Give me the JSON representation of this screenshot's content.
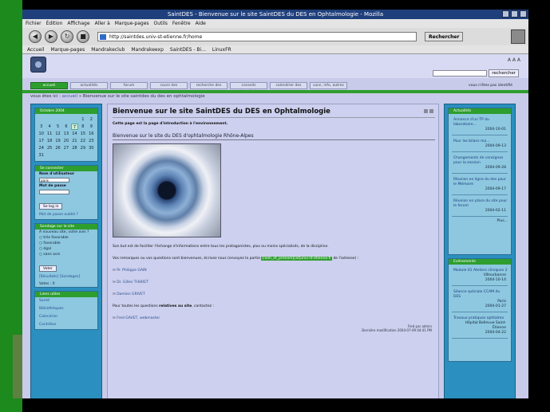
{
  "window": {
    "title": "SaintDES - Bienvenue sur le site SaintDES du DES en Ophtalmologie - Mozilla"
  },
  "menu": [
    "Fichier",
    "Édition",
    "Affichage",
    "Aller à",
    "Marque-pages",
    "Outils",
    "Fenêtre",
    "Aide"
  ],
  "url": "http://saintdes.univ-st-etienne.fr/home",
  "search_button": "Rechercher",
  "bookmarks": [
    "Accueil",
    "Marque-pages",
    "Mandrakeclub",
    "Mandrakeexp",
    "SaintDES - Bi...",
    "LinuxFR"
  ],
  "site": {
    "fontsize": "A A A",
    "search_button": "rechercher",
    "connected_text": "vous n'êtes pas identifié",
    "tabs": [
      "accueil",
      "actualités",
      "forum",
      "cours des",
      "recherche des",
      "conseils universitaires",
      "calendrier des",
      "suivi, info, autres"
    ],
    "breadcrumb_prefix": "vous êtes ici :",
    "breadcrumb_link": "accueil",
    "breadcrumb_current": "» Bienvenue sur le site saintdes du des en ophtalmologie"
  },
  "calendar": {
    "title": "Octobre 2004",
    "days": [
      "",
      "",
      "",
      "",
      "",
      "1",
      "2",
      "3",
      "4",
      "5",
      "6",
      "7",
      "8",
      "9",
      "10",
      "11",
      "12",
      "13",
      "14",
      "15",
      "16",
      "17",
      "18",
      "19",
      "20",
      "21",
      "22",
      "23",
      "24",
      "25",
      "26",
      "27",
      "28",
      "29",
      "30",
      "31"
    ],
    "selected": "7"
  },
  "login": {
    "title": "Se connecter",
    "user_label": "Nom d'utilisateur",
    "user_value": "paris",
    "pass_label": "Mot de passe",
    "button": "Se log in",
    "forgot": "Mot de passe oublié ?"
  },
  "poll": {
    "title": "Sondage sur le site",
    "question": "A nouveau site, votre avis ?",
    "options": [
      "très favorable",
      "favorable",
      "égal",
      "sans avis",
      "Voter"
    ],
    "results": "[Résultats] [Sondages]",
    "votes": "Votes : 0"
  },
  "links": {
    "title": "Liens utiles",
    "items": [
      "Santé",
      "Bibliothèques",
      "Calendrier",
      "Contrôles"
    ]
  },
  "news": {
    "title": "Actualités",
    "items": [
      {
        "title": "Annonce d'un TP du laboratoire...",
        "date": "2004-10-01"
      },
      {
        "title": "Pour les bilans ma...",
        "date": "2004-09-13"
      },
      {
        "title": "Changements de consignes pour la session",
        "date": "2004-09-28"
      },
      {
        "title": "Réunion en ligne du des pour le Mémoire",
        "date": "2004-09-17"
      },
      {
        "title": "Réunion en place du site pour le forum",
        "date": "2004-02-11"
      }
    ],
    "more": "Plus..."
  },
  "events": {
    "title": "Evénements",
    "items": [
      {
        "title": "Module 01 Ateliers cliniques 2",
        "place": "Villeurbanne",
        "date": "2004-10-14"
      },
      {
        "title": "Séance spéciale CCAM du DES",
        "place": "Paris",
        "date": "2004-01-27"
      },
      {
        "title": "Travaux pratiques ophtalmo",
        "place": "Hôpital Bellevue Saint-Étienne",
        "date": "2004-04-22"
      }
    ]
  },
  "main": {
    "title": "Bienvenue sur le site SaintDES du DES en Ophtalmologie",
    "intro": "Cette page est la page d'introduction à l'environnement.",
    "subtitle": "Bienvenue sur le site du DES d'ophtalmologie Rhône-Alpes",
    "para1": "Son but est de faciliter l'échange d'informations entre tous les protagonistes, plus ou moins spécialisés, de la discipline.",
    "para2_pre": "Vos remarques ou vos questions sont bienvenues, écrivez nous (envoyez la partie",
    "para2_hl": "[nom_et_prenom][at]univ-st-etienne.fr",
    "para2_post": "de l'adresse) :",
    "contacts1": [
      "Pr. Philippe GAIN",
      "Dr. Gilles THURET",
      "Damien GRIVET"
    ],
    "para3_pre": "Pour toutes les questions",
    "para3_bold": "relatives au site",
    "para3_post": ", contactez :",
    "contacts2": [
      "Fred GAVET, webmaster"
    ],
    "footer1": "Fred par admin",
    "footer2": "Dernière modification 2004-07-09 04:41 PM"
  }
}
